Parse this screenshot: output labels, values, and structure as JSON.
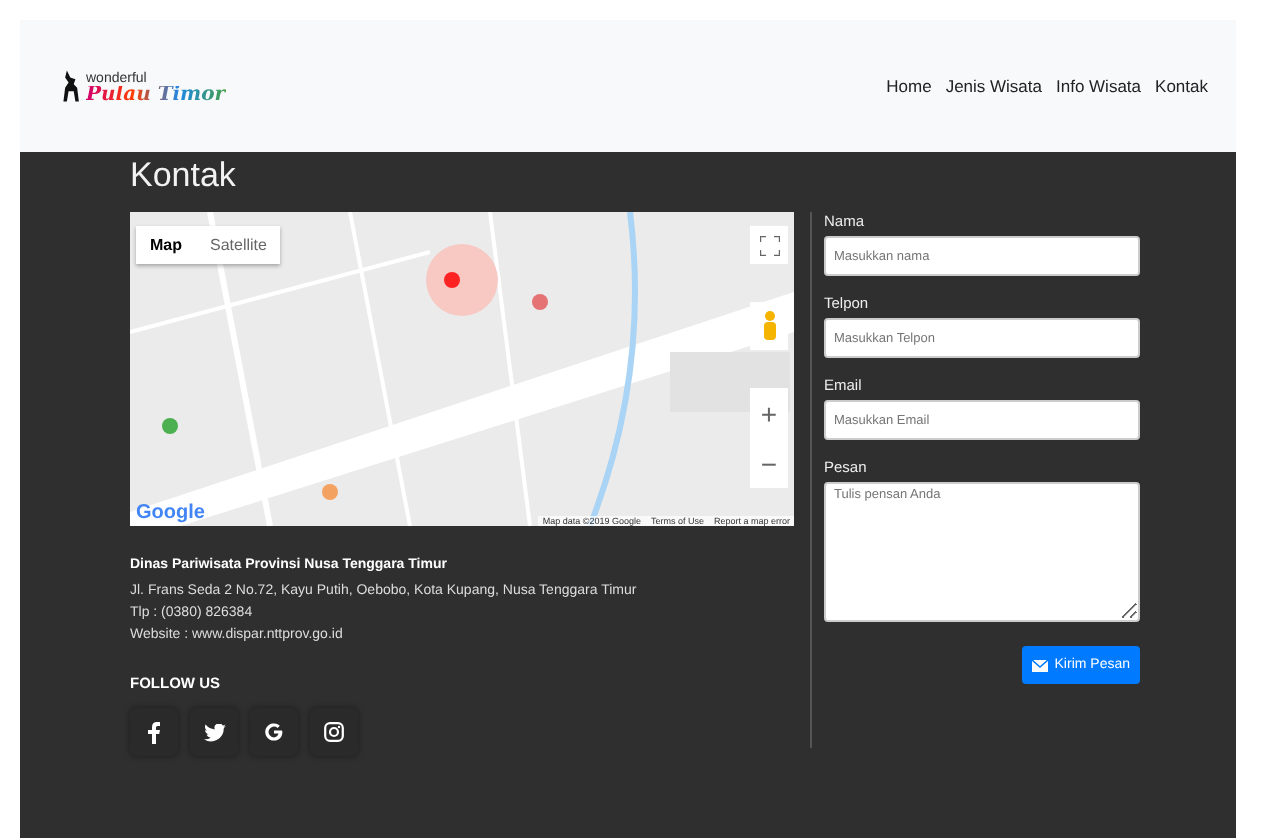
{
  "logo": {
    "top": "wonderful",
    "script": "Pulau Timor"
  },
  "nav": [
    {
      "label": "Home"
    },
    {
      "label": "Jenis Wisata"
    },
    {
      "label": "Info Wisata"
    },
    {
      "label": "Kontak"
    }
  ],
  "title": "Kontak",
  "map": {
    "types": [
      {
        "label": "Map",
        "selected": true
      },
      {
        "label": "Satellite",
        "selected": false
      }
    ],
    "zoom_in": "+",
    "zoom_out": "−",
    "brand": "Google",
    "attribution": [
      "Map data ©2019 Google",
      "Terms of Use",
      "Report a map error"
    ]
  },
  "info": {
    "name": "Dinas Pariwisata Provinsi Nusa Tenggara Timur",
    "address": "Jl. Frans Seda 2 No.72, Kayu Putih, Oebobo, Kota Kupang, Nusa Tenggara Timur",
    "phone": "Tlp : (0380) 826384",
    "website": "Website : www.dispar.nttprov.go.id"
  },
  "follow": {
    "heading": "FOLLOW US",
    "icons": [
      {
        "kind": "facebook"
      },
      {
        "kind": "twitter"
      },
      {
        "kind": "google"
      },
      {
        "kind": "instagram"
      }
    ]
  },
  "form": {
    "fields": [
      {
        "kind": "input",
        "label": "Nama",
        "placeholder": "Masukkan nama"
      },
      {
        "kind": "input",
        "label": "Telpon",
        "placeholder": "Masukkan Telpon"
      },
      {
        "kind": "input",
        "label": "Email",
        "placeholder": "Masukkan Email"
      },
      {
        "kind": "textarea",
        "label": "Pesan",
        "placeholder": "Tulis pensan Anda"
      }
    ],
    "submit": "Kirim Pesan"
  }
}
